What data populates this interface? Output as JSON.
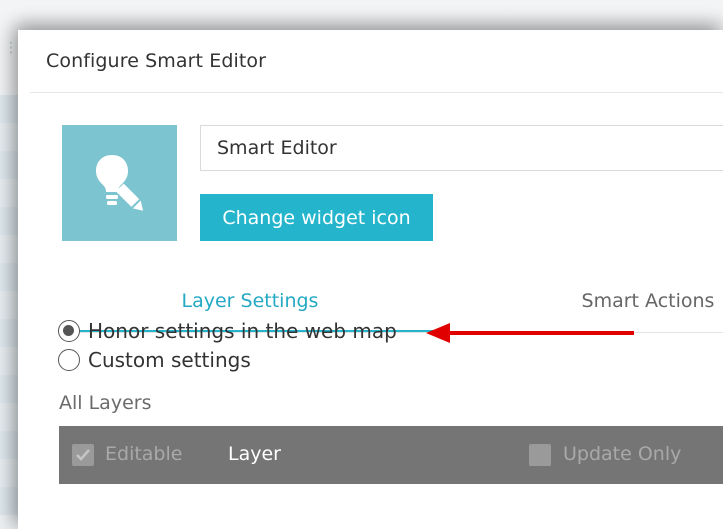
{
  "dialog": {
    "title": "Configure Smart Editor"
  },
  "widget": {
    "icon": "lightbulb-pencil-icon",
    "name_value": "Smart Editor",
    "change_icon_label": "Change widget icon"
  },
  "tabs": [
    {
      "label": "Layer Settings",
      "active": true
    },
    {
      "label": "Smart Actions",
      "active": false
    }
  ],
  "settings_mode": {
    "options": [
      {
        "label": "Honor settings in the web map",
        "checked": true
      },
      {
        "label": "Custom settings",
        "checked": false
      }
    ]
  },
  "layers": {
    "section_label": "All Layers",
    "columns": {
      "editable": "Editable",
      "layer": "Layer",
      "update_only": "Update Only"
    }
  },
  "annotation": {
    "arrow_color": "#e00000"
  },
  "colors": {
    "accent": "#24b5cc",
    "icon_tile": "#7cc4cf",
    "table_header": "#757575"
  }
}
